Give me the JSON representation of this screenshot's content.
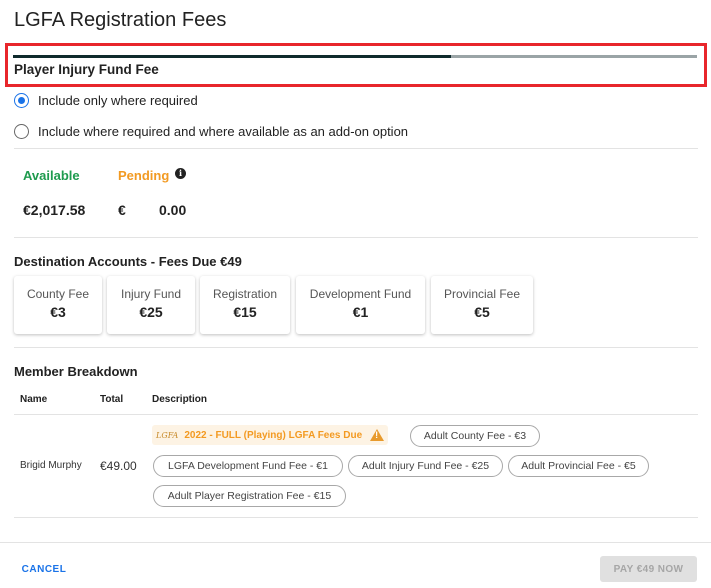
{
  "dialog": {
    "title": "LGFA Registration Fees"
  },
  "section": {
    "heading": "Player Injury Fund Fee",
    "progress": 0.64
  },
  "options": [
    {
      "label": "Include only where required",
      "selected": true
    },
    {
      "label": "Include where required and where available as an add-on option",
      "selected": false
    }
  ],
  "balance": {
    "available_label": "Available",
    "available_value": "€2,017.58",
    "pending_label": "Pending",
    "pending_currency": "€",
    "pending_value": "0.00",
    "info_icon": "i"
  },
  "destination": {
    "heading": "Destination Accounts - Fees Due €49",
    "cards": [
      {
        "label": "County Fee",
        "amount": "€3"
      },
      {
        "label": "Injury Fund",
        "amount": "€25"
      },
      {
        "label": "Registration",
        "amount": "€15"
      },
      {
        "label": "Development Fund",
        "amount": "€1"
      },
      {
        "label": "Provincial Fee",
        "amount": "€5"
      }
    ]
  },
  "members": {
    "heading": "Member Breakdown",
    "columns": {
      "name": "Name",
      "total": "Total",
      "description": "Description"
    },
    "rows": [
      {
        "name": "Brigid Murphy",
        "total": "€49.00",
        "logo_text": "LGFA",
        "due_label": "2022 - FULL (Playing) LGFA Fees Due",
        "chips": [
          "Adult County Fee - €3",
          "LGFA Development Fund Fee - €1",
          "Adult Injury Fund Fee - €25",
          "Adult Provincial Fee - €5",
          "Adult Player Registration Fee - €15"
        ]
      }
    ]
  },
  "footer": {
    "cancel_label": "CANCEL",
    "pay_label": "PAY €49 NOW"
  },
  "colors": {
    "available": "#1e9b4e",
    "pending": "#f29a22",
    "primary": "#1a73e8",
    "highlight": "#e8262b"
  }
}
